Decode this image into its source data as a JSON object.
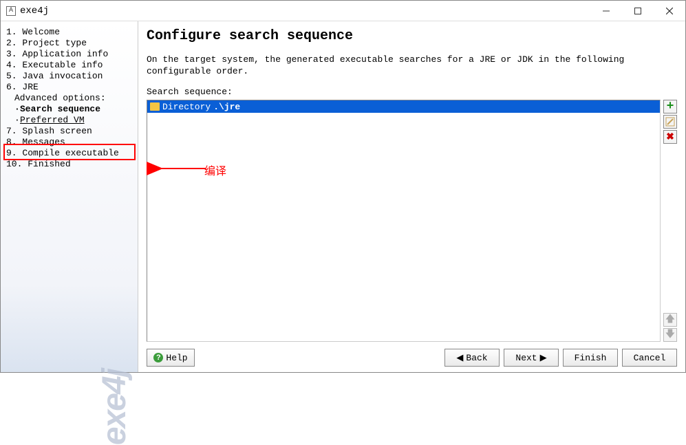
{
  "window": {
    "title": "exe4j"
  },
  "sidebar": {
    "steps": [
      {
        "num": "1.",
        "label": "Welcome"
      },
      {
        "num": "2.",
        "label": "Project type"
      },
      {
        "num": "3.",
        "label": "Application info"
      },
      {
        "num": "4.",
        "label": "Executable info"
      },
      {
        "num": "5.",
        "label": "Java invocation"
      },
      {
        "num": "6.",
        "label": "JRE"
      }
    ],
    "advanced_label": "Advanced options:",
    "advanced_items": [
      {
        "label": "Search sequence",
        "bold": true,
        "underline": false
      },
      {
        "label": "Preferred VM",
        "bold": false,
        "underline": true
      }
    ],
    "steps2": [
      {
        "num": "7.",
        "label": "Splash screen"
      },
      {
        "num": "8.",
        "label": "Messages"
      },
      {
        "num": "9.",
        "label": "Compile executable"
      },
      {
        "num": "10.",
        "label": "Finished"
      }
    ],
    "watermark": "exe4j"
  },
  "main": {
    "heading": "Configure search sequence",
    "description": "On the target system, the generated executable searches for a JRE or JDK in the following configurable order.",
    "seq_label": "Search sequence:",
    "seq_items": [
      {
        "prefix": "Directory ",
        "path": ".\\jre"
      }
    ]
  },
  "buttons": {
    "help": "Help",
    "back": "Back",
    "next": "Next",
    "finish": "Finish",
    "cancel": "Cancel"
  },
  "annotation": {
    "label": "编译"
  }
}
